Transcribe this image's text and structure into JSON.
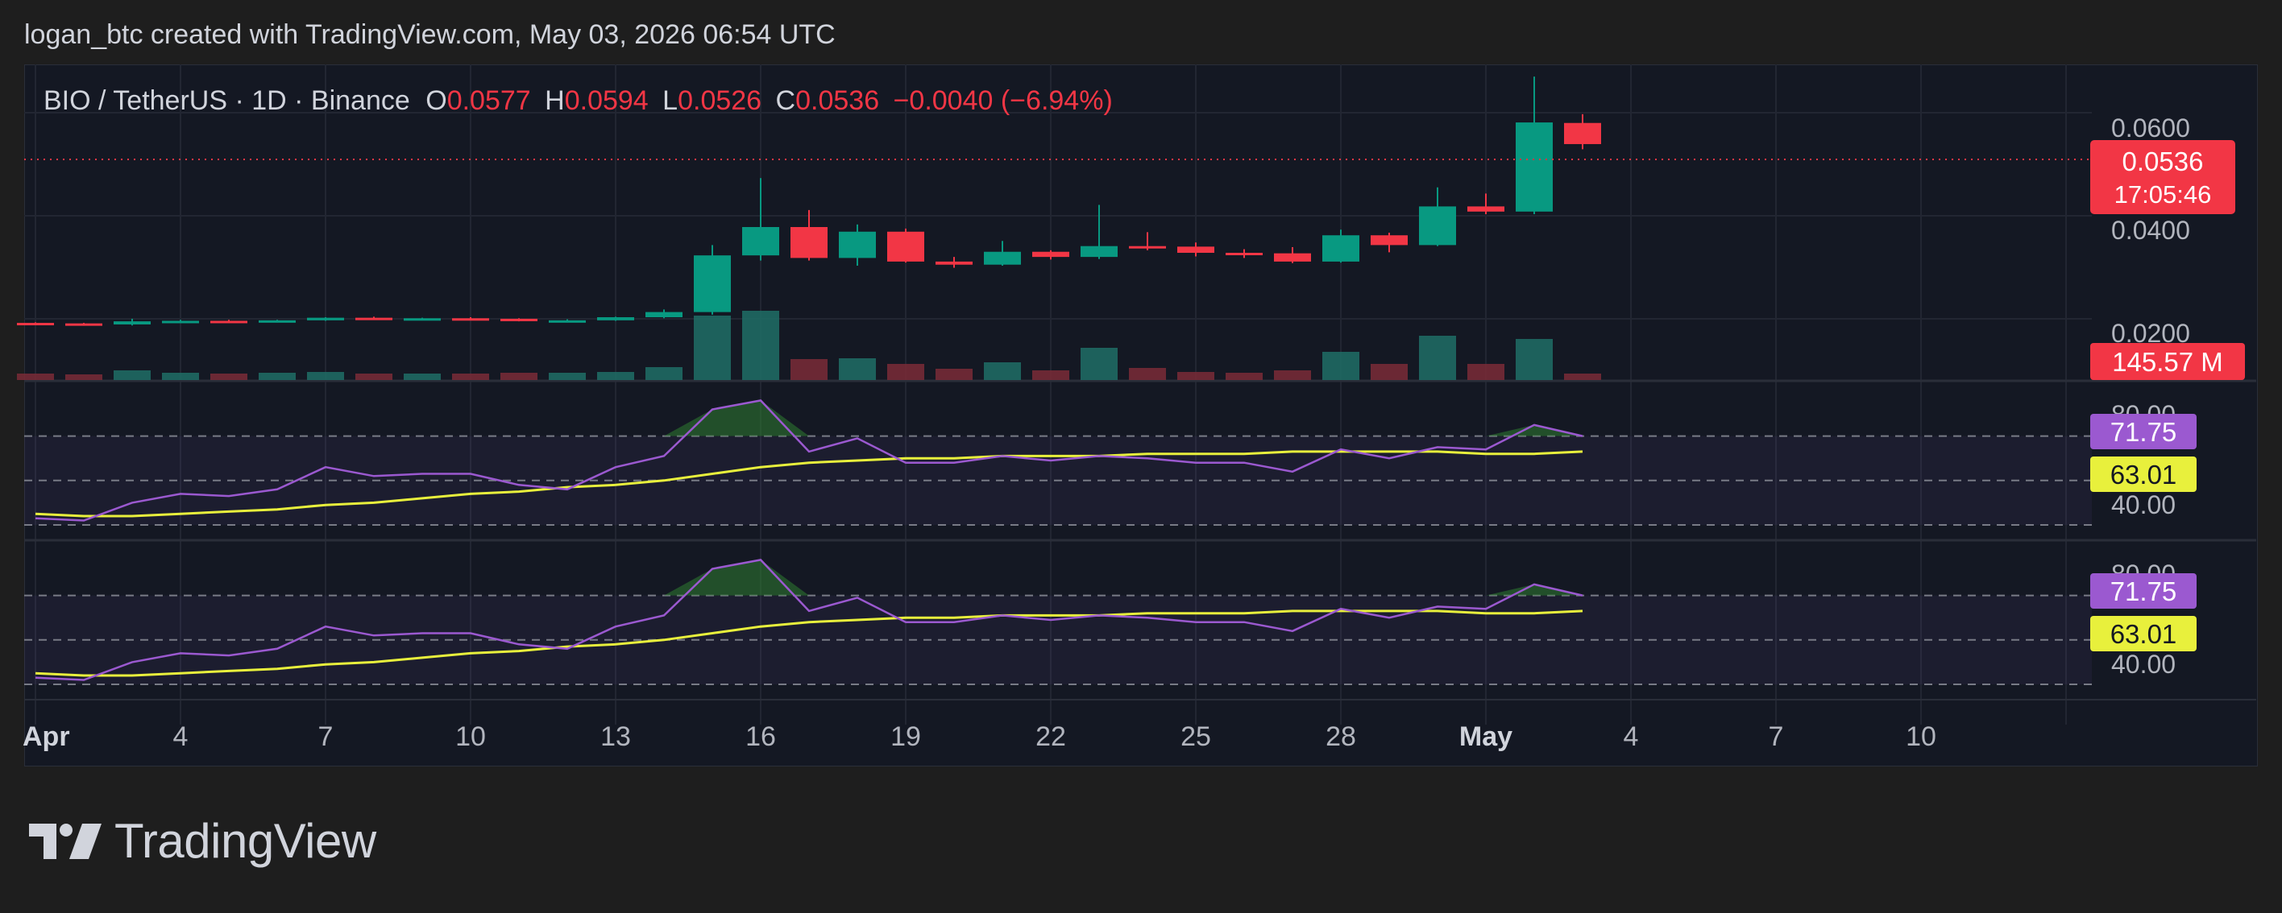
{
  "header": {
    "attribution": "logan_btc created with TradingView.com, May 03, 2026 06:54 UTC"
  },
  "legend": {
    "symbol": "BIO / TetherUS · 1D · Binance",
    "open_label": "O",
    "open": "0.0577",
    "high_label": "H",
    "high": "0.0594",
    "low_label": "L",
    "low": "0.0526",
    "close_label": "C",
    "close": "0.0536",
    "change": "−0.0040 (−6.94%)"
  },
  "price_axis": {
    "ticks": [
      "0.0600",
      "0.0400",
      "0.0200"
    ]
  },
  "badges": {
    "last_price": "0.0536",
    "countdown": "17:05:46",
    "volume": "145.57 M"
  },
  "rsi_panels": [
    {
      "ticks": [
        "80.00",
        "40.00"
      ],
      "rsi_value": "71.75",
      "ma_value": "63.01"
    },
    {
      "ticks": [
        "80.00",
        "40.00"
      ],
      "rsi_value": "71.75",
      "ma_value": "63.01"
    }
  ],
  "time_axis": {
    "labels": [
      "Apr",
      "4",
      "7",
      "10",
      "13",
      "16",
      "19",
      "22",
      "25",
      "28",
      "May",
      "4",
      "7",
      "10"
    ]
  },
  "brand": {
    "name": "TradingView"
  },
  "colors": {
    "up": "#089981",
    "down": "#f23645",
    "rsi": "#9b59d0",
    "rsi_ma": "#e8f03c",
    "background": "#1e1e1e",
    "panel": "#141823"
  },
  "chart_data": {
    "type": "candlestick",
    "interval": "1D",
    "dates": [
      "Apr 1",
      "Apr 2",
      "Apr 3",
      "Apr 4",
      "Apr 5",
      "Apr 6",
      "Apr 7",
      "Apr 8",
      "Apr 9",
      "Apr 10",
      "Apr 11",
      "Apr 12",
      "Apr 13",
      "Apr 14",
      "Apr 15",
      "Apr 16",
      "Apr 17",
      "Apr 18",
      "Apr 19",
      "Apr 20",
      "Apr 21",
      "Apr 22",
      "Apr 23",
      "Apr 24",
      "Apr 25",
      "Apr 26",
      "Apr 27",
      "Apr 28",
      "Apr 29",
      "Apr 30",
      "May 1",
      "May 2",
      "May 3"
    ],
    "ohlc": [
      [
        0.0189,
        0.019,
        0.0187,
        0.0188
      ],
      [
        0.0188,
        0.0189,
        0.0185,
        0.0186
      ],
      [
        0.0186,
        0.0197,
        0.0184,
        0.0192
      ],
      [
        0.0192,
        0.0195,
        0.019,
        0.0193
      ],
      [
        0.0193,
        0.0195,
        0.019,
        0.0191
      ],
      [
        0.0191,
        0.0195,
        0.019,
        0.0194
      ],
      [
        0.0194,
        0.02,
        0.0193,
        0.0199
      ],
      [
        0.0199,
        0.0201,
        0.0196,
        0.0197
      ],
      [
        0.0197,
        0.0199,
        0.0195,
        0.0198
      ],
      [
        0.0198,
        0.02,
        0.0196,
        0.0197
      ],
      [
        0.0197,
        0.0198,
        0.0192,
        0.0193
      ],
      [
        0.0193,
        0.0196,
        0.0191,
        0.0194
      ],
      [
        0.0194,
        0.0201,
        0.0193,
        0.02
      ],
      [
        0.02,
        0.0215,
        0.0198,
        0.021
      ],
      [
        0.021,
        0.034,
        0.0205,
        0.032
      ],
      [
        0.032,
        0.047,
        0.031,
        0.0375
      ],
      [
        0.0375,
        0.0408,
        0.031,
        0.0315
      ],
      [
        0.0315,
        0.038,
        0.03,
        0.0366
      ],
      [
        0.0366,
        0.0372,
        0.0306,
        0.0308
      ],
      [
        0.0308,
        0.0317,
        0.0296,
        0.0302
      ],
      [
        0.0302,
        0.0348,
        0.03,
        0.0327
      ],
      [
        0.0327,
        0.033,
        0.0312,
        0.0317
      ],
      [
        0.0317,
        0.0418,
        0.0313,
        0.0338
      ],
      [
        0.0338,
        0.0365,
        0.033,
        0.0337
      ],
      [
        0.0337,
        0.0345,
        0.0318,
        0.0325
      ],
      [
        0.0325,
        0.0332,
        0.0315,
        0.0324
      ],
      [
        0.0324,
        0.0336,
        0.0305,
        0.0308
      ],
      [
        0.0308,
        0.037,
        0.0306,
        0.0359
      ],
      [
        0.0359,
        0.0364,
        0.0326,
        0.034
      ],
      [
        0.034,
        0.0452,
        0.0338,
        0.0415
      ],
      [
        0.0415,
        0.044,
        0.04,
        0.0405
      ],
      [
        0.0405,
        0.0667,
        0.04,
        0.0578
      ],
      [
        0.0577,
        0.0594,
        0.0526,
        0.0536
      ]
    ],
    "volume_relative": [
      0.08,
      0.07,
      0.12,
      0.09,
      0.08,
      0.09,
      0.1,
      0.08,
      0.08,
      0.08,
      0.09,
      0.09,
      0.1,
      0.16,
      0.8,
      0.86,
      0.26,
      0.27,
      0.2,
      0.14,
      0.22,
      0.12,
      0.4,
      0.15,
      0.1,
      0.09,
      0.12,
      0.35,
      0.2,
      0.55,
      0.2,
      0.51,
      0.08
    ],
    "rsi": [
      33,
      32,
      40,
      44,
      43,
      46,
      56,
      52,
      53,
      53,
      48,
      46,
      56,
      61,
      82,
      86,
      63,
      69,
      58,
      58,
      61,
      59,
      61,
      60,
      58,
      58,
      54,
      64,
      60,
      65,
      64,
      75,
      70
    ],
    "rsi_ma": [
      35,
      34,
      34,
      35,
      36,
      37,
      39,
      40,
      42,
      44,
      45,
      47,
      48,
      50,
      53,
      56,
      58,
      59,
      60,
      60,
      61,
      61,
      61,
      62,
      62,
      62,
      63,
      63,
      63,
      63,
      62,
      62,
      63
    ],
    "price_axis_ticks": [
      0.06,
      0.04,
      0.02
    ],
    "rsi_levels": [
      80,
      70,
      50,
      40,
      30
    ],
    "last_price": 0.0536,
    "volume_last": "145.57 M",
    "rsi_last": 71.75,
    "rsi_ma_last": 63.01
  }
}
